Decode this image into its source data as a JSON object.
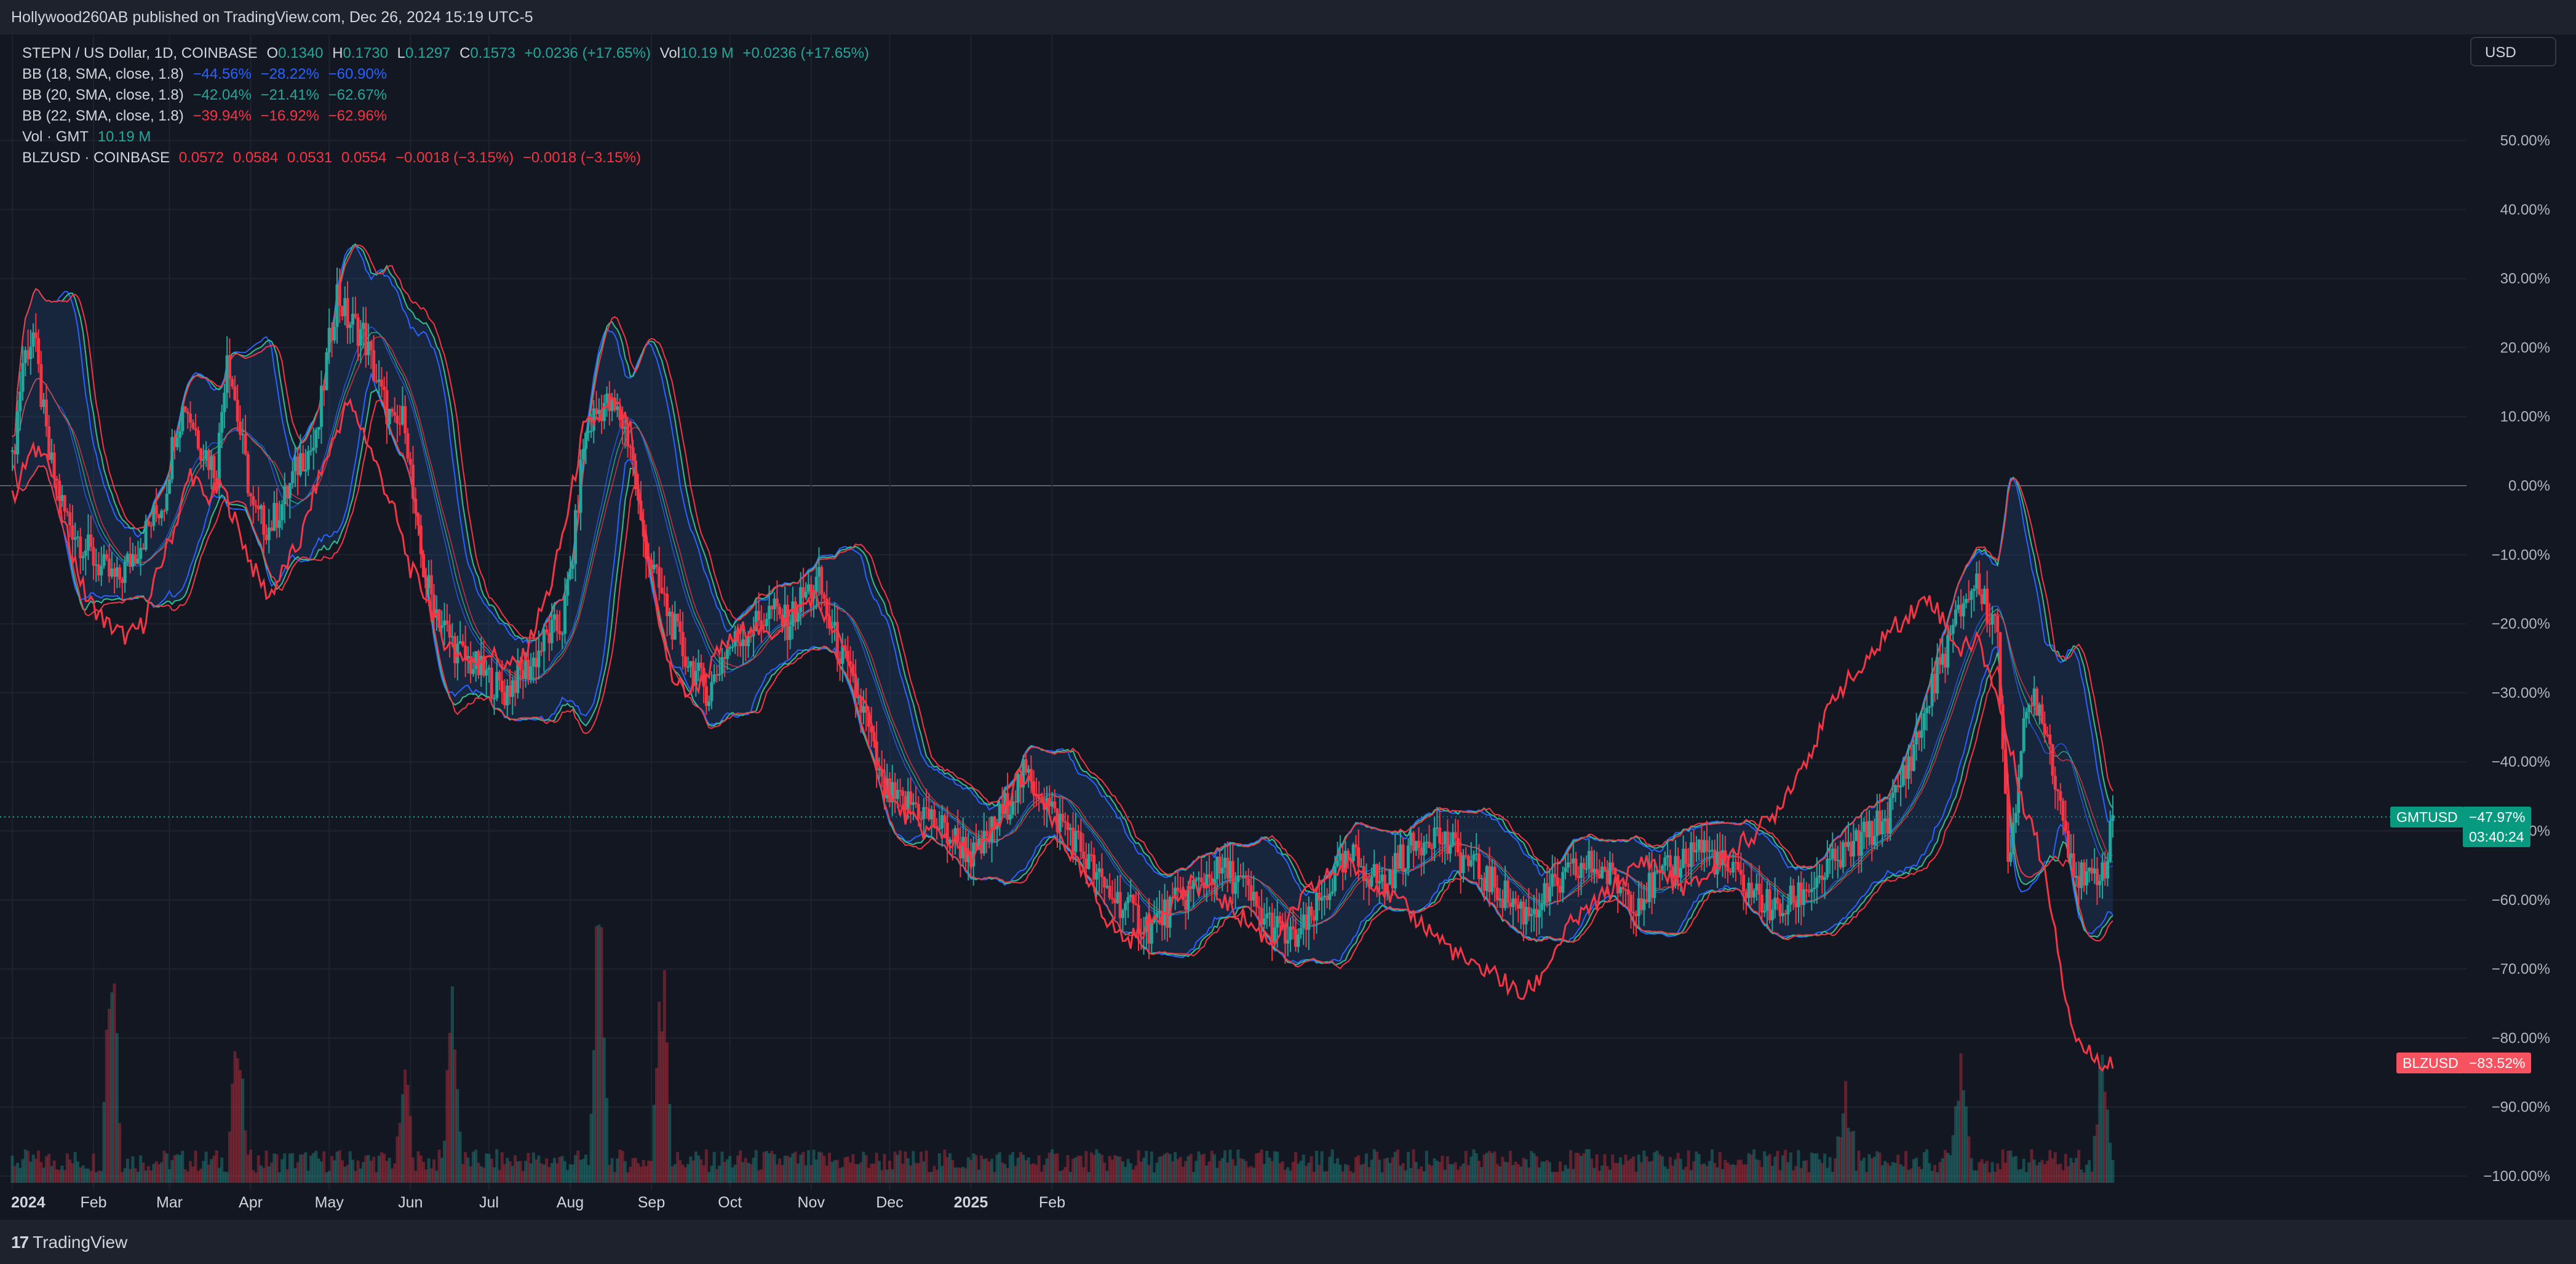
{
  "header": {
    "published": "Hollywood260AB published on TradingView.com, Dec 26, 2024 15:19 UTC-5"
  },
  "legend": {
    "main": {
      "symbol": "STEPN / US Dollar, 1D, COINBASE",
      "o_label": "O",
      "o": "0.1340",
      "h_label": "H",
      "h": "0.1730",
      "l_label": "L",
      "l": "0.1297",
      "c_label": "C",
      "c": "0.1573",
      "change": "+0.0236 (+17.65%)",
      "vol_label": "Vol",
      "vol": "10.19 M",
      "vol_change": "+0.0236 (+17.65%)"
    },
    "bb18": {
      "label": "BB (18, SMA, close, 1.8)",
      "v1": "−44.56%",
      "v2": "−28.22%",
      "v3": "−60.90%"
    },
    "bb20": {
      "label": "BB (20, SMA, close, 1.8)",
      "v1": "−42.04%",
      "v2": "−21.41%",
      "v3": "−62.67%"
    },
    "bb22": {
      "label": "BB (22, SMA, close, 1.8)",
      "v1": "−39.94%",
      "v2": "−16.92%",
      "v3": "−62.96%"
    },
    "vol": {
      "label": "Vol · GMT",
      "value": "10.19 M"
    },
    "compare": {
      "label": "BLZUSD · COINBASE",
      "o": "0.0572",
      "h": "0.0584",
      "l": "0.0531",
      "c": "0.0554",
      "chg1": "−0.0018 (−3.15%)",
      "chg2": "−0.0018 (−3.15%)"
    }
  },
  "currency_button": "USD",
  "price_tags": {
    "gmt": {
      "symbol": "GMTUSD",
      "value": "−47.97%",
      "countdown": "03:40:24"
    },
    "blz": {
      "symbol": "BLZUSD",
      "value": "−83.52%"
    }
  },
  "footer": {
    "brand": "TradingView",
    "logo_glyph": "17"
  },
  "colors": {
    "background": "#131722",
    "up": "#26a69a",
    "down": "#f23645",
    "bb_blue": "#2962ff",
    "bb_green": "#2fbf8f",
    "bb_red": "#f23645",
    "band_fill": "#1e3a5f",
    "compare_line": "#f23645",
    "gmt_tag": "#089981",
    "blz_tag": "#f7525f"
  },
  "chart_data": {
    "type": "candlestick",
    "axis_unit": "percent change from first visible close",
    "y_ticks": [
      "50.00%",
      "40.00%",
      "30.00%",
      "20.00%",
      "10.00%",
      "0.00%",
      "−10.00%",
      "−20.00%",
      "−30.00%",
      "−40.00%",
      "−50.00%",
      "−60.00%",
      "−70.00%",
      "−80.00%",
      "−90.00%",
      "−100.00%"
    ],
    "ylim": [
      -100,
      54
    ],
    "x_ticks": [
      "2024",
      "Feb",
      "Mar",
      "Apr",
      "May",
      "Jun",
      "Jul",
      "Aug",
      "Sep",
      "Oct",
      "Nov",
      "Dec",
      "2025",
      "Feb"
    ],
    "gmt_path": [
      [
        0,
        3
      ],
      [
        4,
        18
      ],
      [
        8,
        22
      ],
      [
        14,
        4
      ],
      [
        20,
        -4
      ],
      [
        26,
        -8
      ],
      [
        34,
        -12
      ],
      [
        40,
        -14
      ],
      [
        46,
        -10
      ],
      [
        52,
        -6
      ],
      [
        58,
        -2
      ],
      [
        62,
        8
      ],
      [
        66,
        12
      ],
      [
        72,
        6
      ],
      [
        78,
        2
      ],
      [
        82,
        20
      ],
      [
        86,
        10
      ],
      [
        92,
        -4
      ],
      [
        98,
        -6
      ],
      [
        104,
        -2
      ],
      [
        110,
        4
      ],
      [
        116,
        6
      ],
      [
        120,
        18
      ],
      [
        124,
        28
      ],
      [
        128,
        24
      ],
      [
        134,
        22
      ],
      [
        140,
        14
      ],
      [
        146,
        8
      ],
      [
        150,
        10
      ],
      [
        154,
        -6
      ],
      [
        158,
        -14
      ],
      [
        164,
        -20
      ],
      [
        170,
        -24
      ],
      [
        176,
        -26
      ],
      [
        182,
        -28
      ],
      [
        188,
        -30
      ],
      [
        192,
        -28
      ],
      [
        198,
        -26
      ],
      [
        204,
        -22
      ],
      [
        210,
        -20
      ],
      [
        214,
        -10
      ],
      [
        218,
        6
      ],
      [
        222,
        10
      ],
      [
        226,
        12
      ],
      [
        232,
        10
      ],
      [
        236,
        6
      ],
      [
        240,
        -6
      ],
      [
        246,
        -14
      ],
      [
        250,
        -18
      ],
      [
        256,
        -24
      ],
      [
        262,
        -28
      ],
      [
        266,
        -30
      ],
      [
        272,
        -24
      ],
      [
        278,
        -22
      ],
      [
        284,
        -20
      ],
      [
        290,
        -18
      ],
      [
        296,
        -20
      ],
      [
        302,
        -16
      ],
      [
        308,
        -14
      ],
      [
        312,
        -20
      ],
      [
        316,
        -24
      ],
      [
        320,
        -28
      ],
      [
        326,
        -34
      ],
      [
        332,
        -44
      ],
      [
        338,
        -46
      ],
      [
        344,
        -46
      ],
      [
        350,
        -48
      ],
      [
        356,
        -50
      ],
      [
        362,
        -52
      ],
      [
        368,
        -54
      ],
      [
        374,
        -50
      ],
      [
        380,
        -46
      ],
      [
        386,
        -42
      ],
      [
        392,
        -44
      ],
      [
        398,
        -48
      ],
      [
        404,
        -50
      ],
      [
        410,
        -54
      ],
      [
        416,
        -58
      ],
      [
        422,
        -60
      ],
      [
        428,
        -62
      ],
      [
        434,
        -64
      ],
      [
        440,
        -62
      ],
      [
        446,
        -60
      ],
      [
        452,
        -58
      ],
      [
        458,
        -56
      ],
      [
        464,
        -56
      ],
      [
        470,
        -58
      ],
      [
        476,
        -62
      ],
      [
        482,
        -64
      ],
      [
        488,
        -66
      ],
      [
        494,
        -64
      ],
      [
        500,
        -60
      ],
      [
        506,
        -56
      ],
      [
        512,
        -54
      ],
      [
        518,
        -56
      ],
      [
        524,
        -58
      ],
      [
        530,
        -54
      ],
      [
        536,
        -52
      ],
      [
        542,
        -50
      ],
      [
        548,
        -52
      ],
      [
        554,
        -54
      ],
      [
        560,
        -56
      ],
      [
        566,
        -58
      ],
      [
        572,
        -60
      ],
      [
        578,
        -62
      ],
      [
        584,
        -60
      ],
      [
        590,
        -58
      ],
      [
        596,
        -56
      ],
      [
        602,
        -55
      ],
      [
        608,
        -56
      ],
      [
        614,
        -58
      ],
      [
        620,
        -60
      ],
      [
        626,
        -58
      ],
      [
        632,
        -56
      ],
      [
        638,
        -54
      ],
      [
        644,
        -52
      ],
      [
        650,
        -54
      ],
      [
        656,
        -56
      ],
      [
        662,
        -58
      ],
      [
        668,
        -60
      ],
      [
        674,
        -62
      ],
      [
        680,
        -60
      ],
      [
        686,
        -58
      ],
      [
        692,
        -56
      ],
      [
        698,
        -54
      ],
      [
        704,
        -52
      ],
      [
        710,
        -50
      ],
      [
        716,
        -48
      ],
      [
        722,
        -42
      ],
      [
        728,
        -36
      ],
      [
        734,
        -28
      ],
      [
        740,
        -22
      ],
      [
        746,
        -16
      ],
      [
        750,
        -14
      ],
      [
        754,
        -18
      ],
      [
        758,
        -20
      ],
      [
        760,
        -40
      ],
      [
        762,
        -54
      ],
      [
        764,
        -48
      ],
      [
        768,
        -36
      ],
      [
        772,
        -30
      ],
      [
        776,
        -34
      ],
      [
        780,
        -42
      ],
      [
        784,
        -50
      ],
      [
        788,
        -56
      ],
      [
        792,
        -58
      ],
      [
        796,
        -56
      ],
      [
        800,
        -54
      ],
      [
        802,
        -48
      ]
    ],
    "blz_path": [
      [
        0,
        -2
      ],
      [
        6,
        4
      ],
      [
        12,
        6
      ],
      [
        20,
        -6
      ],
      [
        28,
        -16
      ],
      [
        36,
        -20
      ],
      [
        44,
        -22
      ],
      [
        50,
        -20
      ],
      [
        56,
        -12
      ],
      [
        62,
        -6
      ],
      [
        68,
        2
      ],
      [
        74,
        -2
      ],
      [
        80,
        0
      ],
      [
        86,
        -6
      ],
      [
        92,
        -12
      ],
      [
        98,
        -16
      ],
      [
        104,
        -12
      ],
      [
        110,
        -8
      ],
      [
        116,
        0
      ],
      [
        122,
        6
      ],
      [
        128,
        12
      ],
      [
        134,
        8
      ],
      [
        140,
        2
      ],
      [
        146,
        -4
      ],
      [
        152,
        -12
      ],
      [
        158,
        -16
      ],
      [
        164,
        -22
      ],
      [
        170,
        -24
      ],
      [
        176,
        -26
      ],
      [
        182,
        -24
      ],
      [
        188,
        -26
      ],
      [
        194,
        -26
      ],
      [
        200,
        -20
      ],
      [
        206,
        -14
      ],
      [
        212,
        -4
      ],
      [
        218,
        8
      ],
      [
        224,
        10
      ],
      [
        230,
        12
      ],
      [
        236,
        8
      ],
      [
        240,
        -4
      ],
      [
        244,
        -12
      ],
      [
        248,
        -22
      ],
      [
        252,
        -28
      ],
      [
        258,
        -30
      ],
      [
        264,
        -28
      ],
      [
        270,
        -24
      ],
      [
        276,
        -22
      ],
      [
        282,
        -20
      ],
      [
        288,
        -22
      ],
      [
        294,
        -20
      ],
      [
        300,
        -18
      ],
      [
        306,
        -16
      ],
      [
        312,
        -20
      ],
      [
        318,
        -24
      ],
      [
        324,
        -30
      ],
      [
        330,
        -38
      ],
      [
        336,
        -46
      ],
      [
        342,
        -48
      ],
      [
        348,
        -50
      ],
      [
        354,
        -50
      ],
      [
        360,
        -52
      ],
      [
        366,
        -54
      ],
      [
        372,
        -52
      ],
      [
        378,
        -48
      ],
      [
        384,
        -42
      ],
      [
        390,
        -44
      ],
      [
        396,
        -48
      ],
      [
        402,
        -52
      ],
      [
        408,
        -56
      ],
      [
        414,
        -60
      ],
      [
        420,
        -64
      ],
      [
        426,
        -66
      ],
      [
        432,
        -64
      ],
      [
        438,
        -62
      ],
      [
        444,
        -60
      ],
      [
        450,
        -58
      ],
      [
        456,
        -58
      ],
      [
        462,
        -60
      ],
      [
        468,
        -62
      ],
      [
        474,
        -64
      ],
      [
        480,
        -66
      ],
      [
        486,
        -64
      ],
      [
        492,
        -60
      ],
      [
        498,
        -58
      ],
      [
        504,
        -56
      ],
      [
        510,
        -55
      ],
      [
        516,
        -56
      ],
      [
        522,
        -58
      ],
      [
        528,
        -60
      ],
      [
        534,
        -62
      ],
      [
        540,
        -64
      ],
      [
        546,
        -66
      ],
      [
        552,
        -68
      ],
      [
        558,
        -70
      ],
      [
        564,
        -70
      ],
      [
        570,
        -72
      ],
      [
        576,
        -74
      ],
      [
        582,
        -72
      ],
      [
        588,
        -68
      ],
      [
        594,
        -64
      ],
      [
        600,
        -62
      ],
      [
        606,
        -60
      ],
      [
        612,
        -58
      ],
      [
        618,
        -56
      ],
      [
        624,
        -54
      ],
      [
        630,
        -56
      ],
      [
        636,
        -58
      ],
      [
        642,
        -58
      ],
      [
        648,
        -56
      ],
      [
        654,
        -54
      ],
      [
        660,
        -52
      ],
      [
        666,
        -50
      ],
      [
        672,
        -48
      ],
      [
        678,
        -44
      ],
      [
        684,
        -40
      ],
      [
        690,
        -36
      ],
      [
        696,
        -30
      ],
      [
        702,
        -28
      ],
      [
        708,
        -26
      ],
      [
        714,
        -22
      ],
      [
        720,
        -20
      ],
      [
        726,
        -18
      ],
      [
        732,
        -16
      ],
      [
        738,
        -20
      ],
      [
        744,
        -24
      ],
      [
        750,
        -22
      ],
      [
        756,
        -28
      ],
      [
        760,
        -34
      ],
      [
        764,
        -40
      ],
      [
        768,
        -46
      ],
      [
        772,
        -50
      ],
      [
        776,
        -56
      ],
      [
        780,
        -64
      ],
      [
        784,
        -74
      ],
      [
        788,
        -80
      ],
      [
        792,
        -82
      ],
      [
        796,
        -83
      ],
      [
        800,
        -83.5
      ],
      [
        802,
        -83.5
      ]
    ],
    "volume_spikes": [
      [
        38,
        3.5
      ],
      [
        86,
        2.0
      ],
      [
        150,
        1.2
      ],
      [
        168,
        2.4
      ],
      [
        224,
        4.0
      ],
      [
        248,
        3.2
      ],
      [
        700,
        1.0
      ],
      [
        744,
        1.8
      ],
      [
        798,
        1.6
      ]
    ]
  }
}
